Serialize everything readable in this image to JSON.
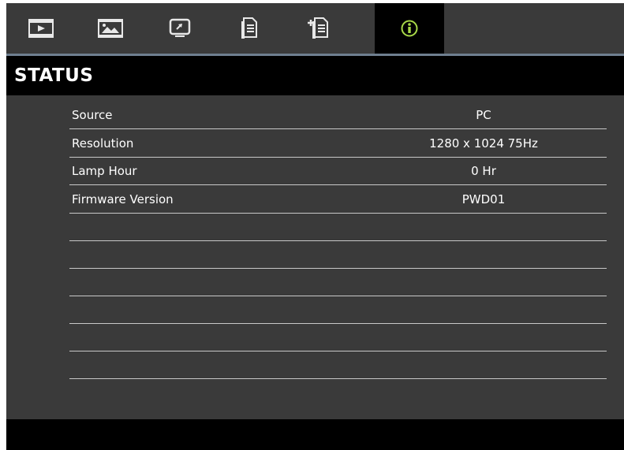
{
  "tabs": [
    {
      "icon": "picture-play-icon",
      "active": false
    },
    {
      "icon": "image-settings-icon",
      "active": false
    },
    {
      "icon": "display-screen-icon",
      "active": false
    },
    {
      "icon": "setup-document-icon",
      "active": false
    },
    {
      "icon": "advanced-setup-icon",
      "active": false
    },
    {
      "icon": "info-icon",
      "active": true
    }
  ],
  "header": {
    "title": "STATUS"
  },
  "rows": [
    {
      "label": "Source",
      "value": "PC"
    },
    {
      "label": "Resolution",
      "value": "1280 x 1024 75Hz"
    },
    {
      "label": "Lamp Hour",
      "value": "0 Hr"
    },
    {
      "label": "Firmware Version",
      "value": "PWD01"
    },
    {
      "label": "",
      "value": ""
    },
    {
      "label": "",
      "value": ""
    },
    {
      "label": "",
      "value": ""
    },
    {
      "label": "",
      "value": ""
    },
    {
      "label": "",
      "value": ""
    },
    {
      "label": "",
      "value": ""
    }
  ],
  "colors": {
    "active_icon": "#a8d848",
    "icon": "#e8e8e8",
    "tab_underline": "#6f7f90"
  }
}
